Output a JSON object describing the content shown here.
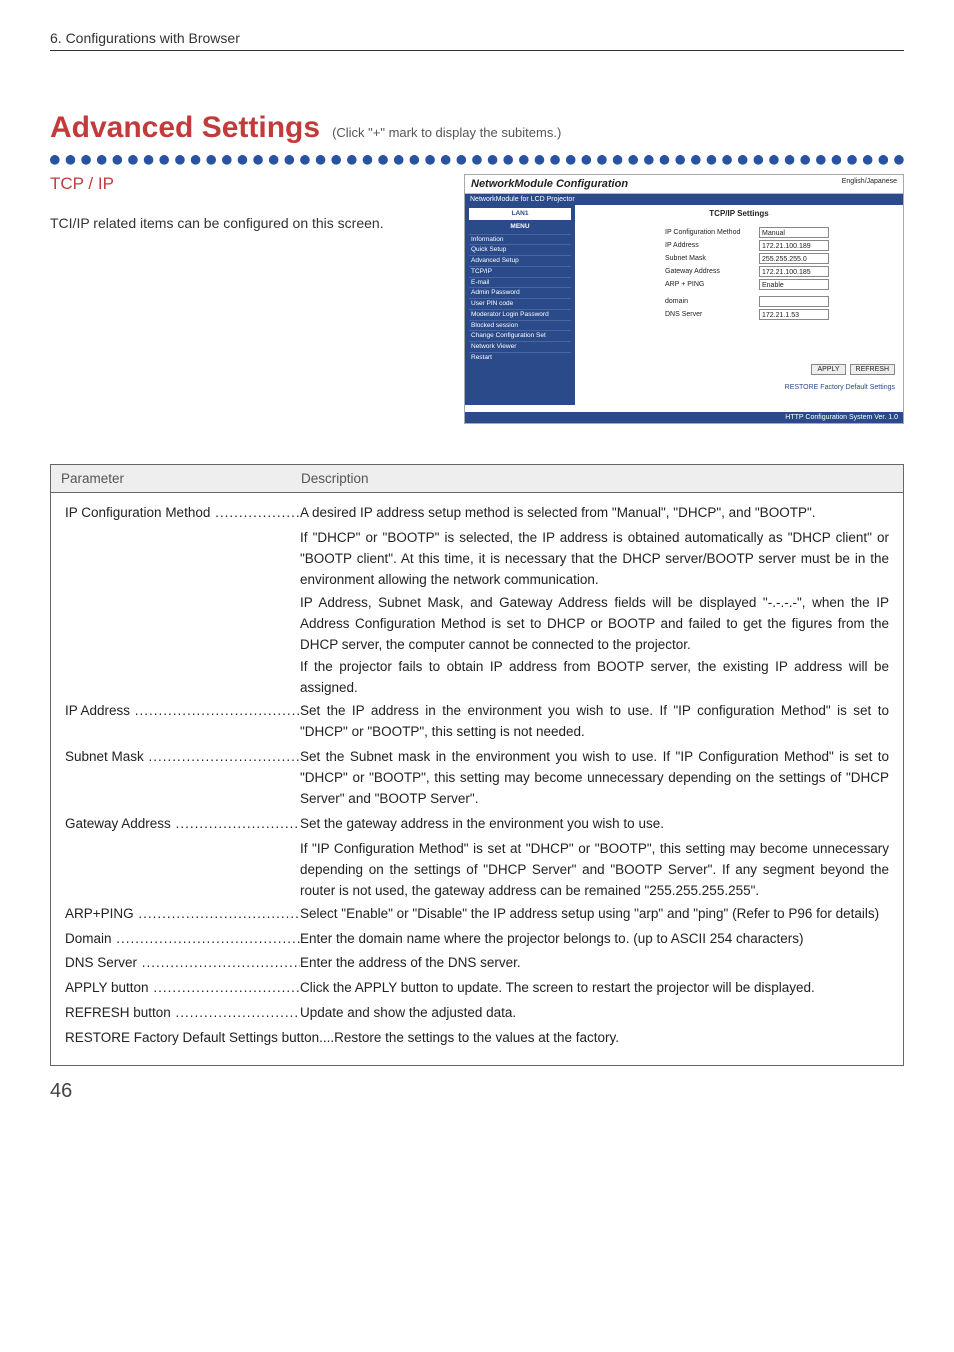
{
  "chapter": "6. Configurations with Browser",
  "title": "Advanced Settings",
  "subtitle": "(Click \"+\" mark to display the subitems.)",
  "section_heading": "TCP / IP",
  "intro_text": "TCI/IP related items can be configured on this screen.",
  "page_number": "46",
  "screenshot": {
    "app_title": "NetworkModule Configuration",
    "lang_link": "English/Japanese",
    "bar": "NetworkModule for LCD Projector",
    "menu": {
      "tab": "LAN1",
      "header": "MENU",
      "items": [
        "Information",
        "Quick Setup",
        "Advanced Setup",
        "TCP/IP",
        "E-mail",
        "Admin Password",
        "User PIN code",
        "Moderator Login Password",
        "Blocked session",
        "Change Configuration Set",
        "Network Viewer",
        "Restart"
      ]
    },
    "content": {
      "title": "TCP/IP Settings",
      "rows": [
        {
          "label": "IP Configuration Method",
          "value": "Manual"
        },
        {
          "label": "IP Address",
          "value": "172.21.100.189"
        },
        {
          "label": "Subnet Mask",
          "value": "255.255.255.0"
        },
        {
          "label": "Gateway Address",
          "value": "172.21.100.185"
        },
        {
          "label": "ARP + PING",
          "value": "Enable"
        },
        {
          "label": "domain",
          "value": ""
        },
        {
          "label": "DNS Server",
          "value": "172.21.1.53"
        }
      ],
      "apply": "APPLY",
      "refresh": "REFRESH",
      "restore": "RESTORE Factory Default Settings",
      "footer": "HTTP Configuration System Ver. 1.0"
    }
  },
  "param_table": {
    "h1": "Parameter",
    "h2": "Description",
    "rows": {
      "ipconf_label": "IP Configuration Method",
      "ipconf_line1": "A desired IP address setup method is selected from \"Manual\", \"DHCP\", and \"BOOTP\".",
      "ipconf_p2": "If \"DHCP\" or \"BOOTP\" is selected, the IP address is obtained automatically as \"DHCP client\" or \"BOOTP client\".  At this time, it is necessary that the DHCP server/BOOTP server must be in the environment allowing the network communication.",
      "ipconf_p3": "IP Address, Subnet Mask, and Gateway Address fields will be displayed \"-.-.-.-\", when the IP Address Configuration Method is set to DHCP or BOOTP and failed to get the figures from the DHCP server, the computer cannot be connected to the projector.",
      "ipconf_p4": "If the projector fails to obtain IP address from BOOTP server, the existing IP address will be assigned.",
      "ipaddr_label": "IP Address",
      "ipaddr_desc": "Set the IP address in the environment you wish to use. If \"IP configuration Method\" is set to \"DHCP\" or \"BOOTP\", this setting is not needed.",
      "subnet_label": "Subnet Mask",
      "subnet_desc": "Set the Subnet mask in the environment you wish to use. If \"IP Configuration Method\" is set to \"DHCP\" or \"BOOTP\", this setting may become unnecessary depending on the settings of \"DHCP Server\" and \"BOOTP Server\".",
      "gateway_label": "Gateway Address",
      "gateway_desc": "Set the gateway address in the environment you wish to use.",
      "gateway_p2": "If \"IP Configuration Method\" is set at \"DHCP\" or \"BOOTP\", this setting may become unnecessary depending on the settings of \"DHCP Server\" and \"BOOTP Server\". If any segment beyond the router is not used, the gateway address can be remained \"255.255.255.255\".",
      "arp_label": "ARP+PING",
      "arp_desc": "Select \"Enable\" or \"Disable\" the IP address setup using \"arp\" and \"ping\" (Refer to P96 for details)",
      "domain_label": "Domain",
      "domain_desc": "Enter the domain name where the projector belongs to. (up to ASCII 254 characters)",
      "dns_label": "DNS Server",
      "dns_desc": "Enter the address of the DNS server.",
      "apply_label": "APPLY button",
      "apply_desc": "Click the APPLY button to update. The screen to restart the projector will be displayed.",
      "refresh_label": "REFRESH button",
      "refresh_desc": "Update and show the adjusted data.",
      "restore_label": "RESTORE Factory Default Settings button",
      "restore_desc": "Restore the settings to the values at the factory."
    }
  }
}
